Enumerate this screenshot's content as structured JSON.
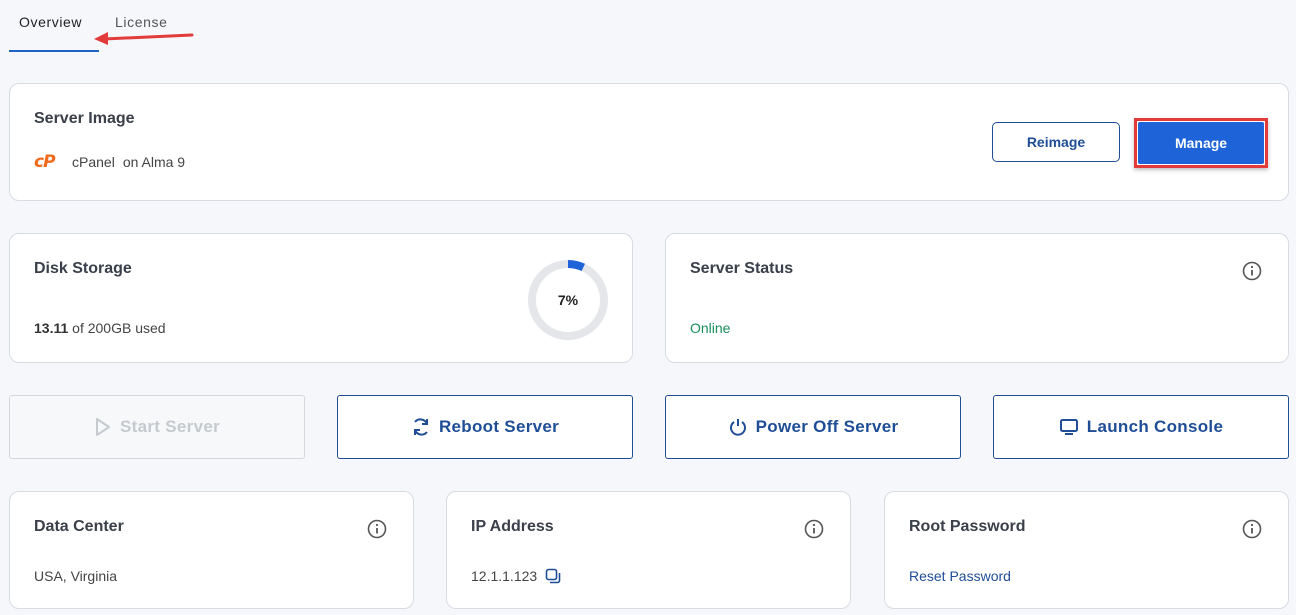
{
  "tabs": [
    {
      "label": "Overview",
      "active": true
    },
    {
      "label": "License",
      "active": false
    }
  ],
  "server_image": {
    "title": "Server Image",
    "logo_text": "cP",
    "os_name": "cPanel",
    "os_suffix": "on Alma 9",
    "reimage_label": "Reimage",
    "manage_label": "Manage"
  },
  "disk": {
    "title": "Disk Storage",
    "used": "13.11",
    "rest": "of 200GB used",
    "percent_label": "7%",
    "percent": 7
  },
  "status": {
    "title": "Server Status",
    "value": "Online"
  },
  "actions": {
    "start": "Start Server",
    "reboot": "Reboot Server",
    "poweroff": "Power Off Server",
    "console": "Launch Console"
  },
  "datacenter": {
    "title": "Data Center",
    "value": "USA, Virginia"
  },
  "ip": {
    "title": "IP Address",
    "value": "12.1.1.123"
  },
  "root": {
    "title": "Root Password",
    "link": "Reset Password"
  },
  "colors": {
    "accent": "#1f63d9",
    "accent_dark": "#1f4e96",
    "online": "#1a8f5a",
    "annotation": "#e23b3b",
    "cpanel": "#f06a1b"
  }
}
